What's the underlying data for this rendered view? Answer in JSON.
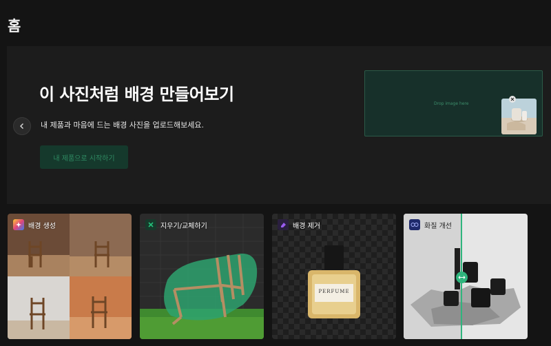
{
  "page": {
    "title": "홈"
  },
  "banner": {
    "heading": "이 사진처럼 배경 만들어보기",
    "subtitle": "내 제품과 마음에 드는 배경 사진을 업로드해보세요.",
    "start_button": "내 제품으로 시작하기",
    "drop_zone_label": "Drop image here",
    "prev_icon": "chevron-left-icon"
  },
  "cards": [
    {
      "label": "배경 생성",
      "icon": "gradient-sparkle-icon",
      "accent": "#e0457b"
    },
    {
      "label": "지우기/교체하기",
      "icon": "cross-swap-icon",
      "accent": "#25c07a"
    },
    {
      "label": "배경 제거",
      "icon": "eraser-icon",
      "accent": "#9a5cf0"
    },
    {
      "label": "화질 개선",
      "icon": "enhance-icon",
      "accent": "#4f63e8"
    }
  ],
  "product": {
    "bottle_text": "PERFUME"
  },
  "colors": {
    "background": "#141414",
    "banner": "#1c1c1c",
    "accent_green": "#2f8a62"
  }
}
